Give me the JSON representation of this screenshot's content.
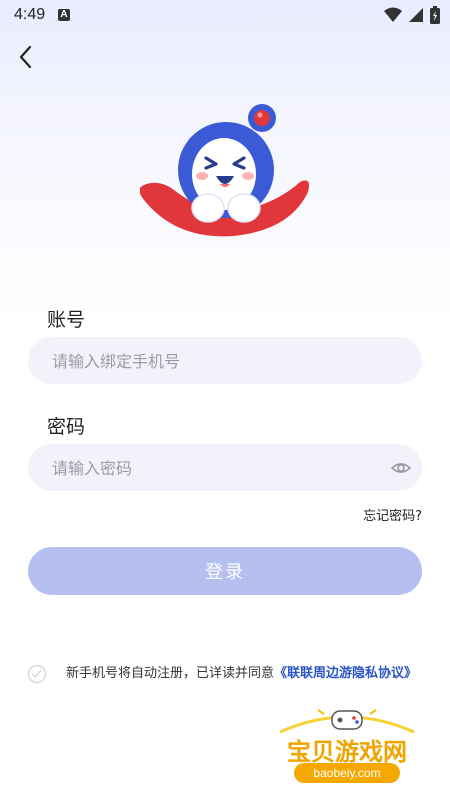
{
  "status_bar": {
    "time": "4:49",
    "notification_letter": "A",
    "icons": [
      "wifi-icon",
      "signal-icon",
      "battery-icon"
    ]
  },
  "header": {
    "back_icon": "chevron-left-icon"
  },
  "form": {
    "account_label": "账号",
    "account_placeholder": "请输入绑定手机号",
    "account_value": "",
    "password_label": "密码",
    "password_placeholder": "请输入密码",
    "password_value": "",
    "password_toggle_icon": "eye-icon",
    "forgot_password": "忘记密码?",
    "login_button": "登录"
  },
  "agreement": {
    "checked": false,
    "text": "新手机号将自动注册，已详读并同意",
    "link_text": "《联联周边游隐私协议》"
  },
  "watermark": {
    "title": "宝贝游戏网",
    "url": "baobeiy.com"
  },
  "colors": {
    "primary_button": "#b5c0f0",
    "link": "#2d55c8",
    "input_bg": "#f2f3fa",
    "mascot_blue": "#3b5bd6",
    "mascot_red": "#e2373a"
  }
}
